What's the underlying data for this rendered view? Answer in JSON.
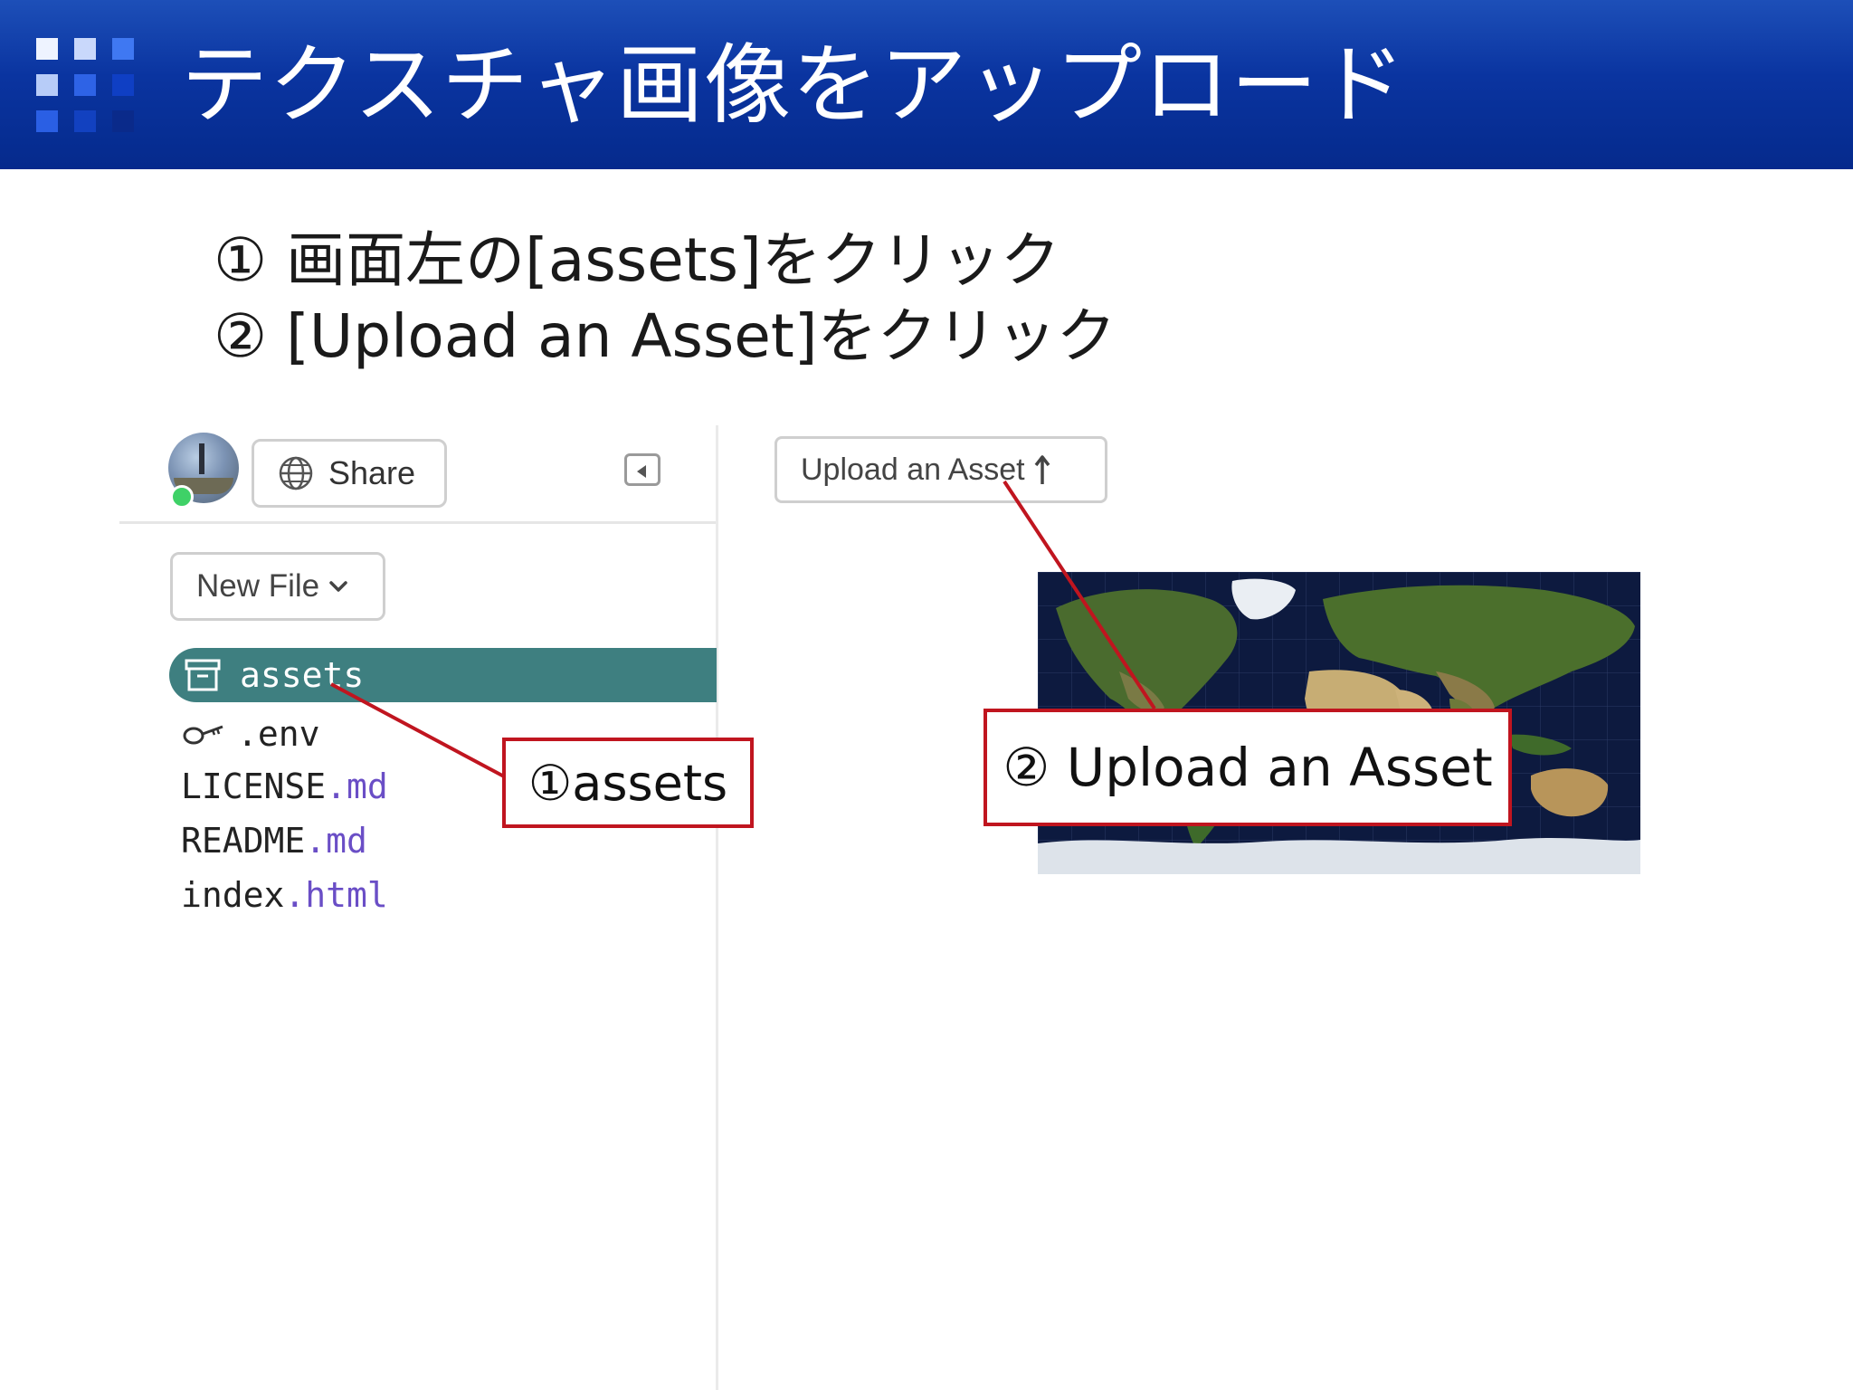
{
  "header": {
    "title": "テクスチャ画像をアップロード"
  },
  "instructions": [
    "① 画面左の[assets]をクリック",
    "② [Upload an Asset]をクリック"
  ],
  "sidebar": {
    "share_label": "Share",
    "new_file_label": "New File",
    "files": [
      {
        "name": "assets",
        "ext": "",
        "selected": true,
        "icon": "archive-box-icon"
      },
      {
        "name": ".env",
        "ext": "",
        "selected": false,
        "icon": "key-icon"
      },
      {
        "name": "LICENSE",
        "ext": ".md",
        "selected": false
      },
      {
        "name": "README",
        "ext": ".md",
        "selected": false
      },
      {
        "name": "index",
        "ext": ".html",
        "selected": false
      }
    ]
  },
  "main": {
    "upload_label": "Upload an Asset"
  },
  "callouts": {
    "assets": "①assets",
    "upload": "② Upload an Asset"
  },
  "colors": {
    "header": "#0a34a0",
    "selected_file": "#3e7f80",
    "callout_border": "#c0151f",
    "file_ext": "#6a4ec6",
    "online": "#3fd167"
  }
}
